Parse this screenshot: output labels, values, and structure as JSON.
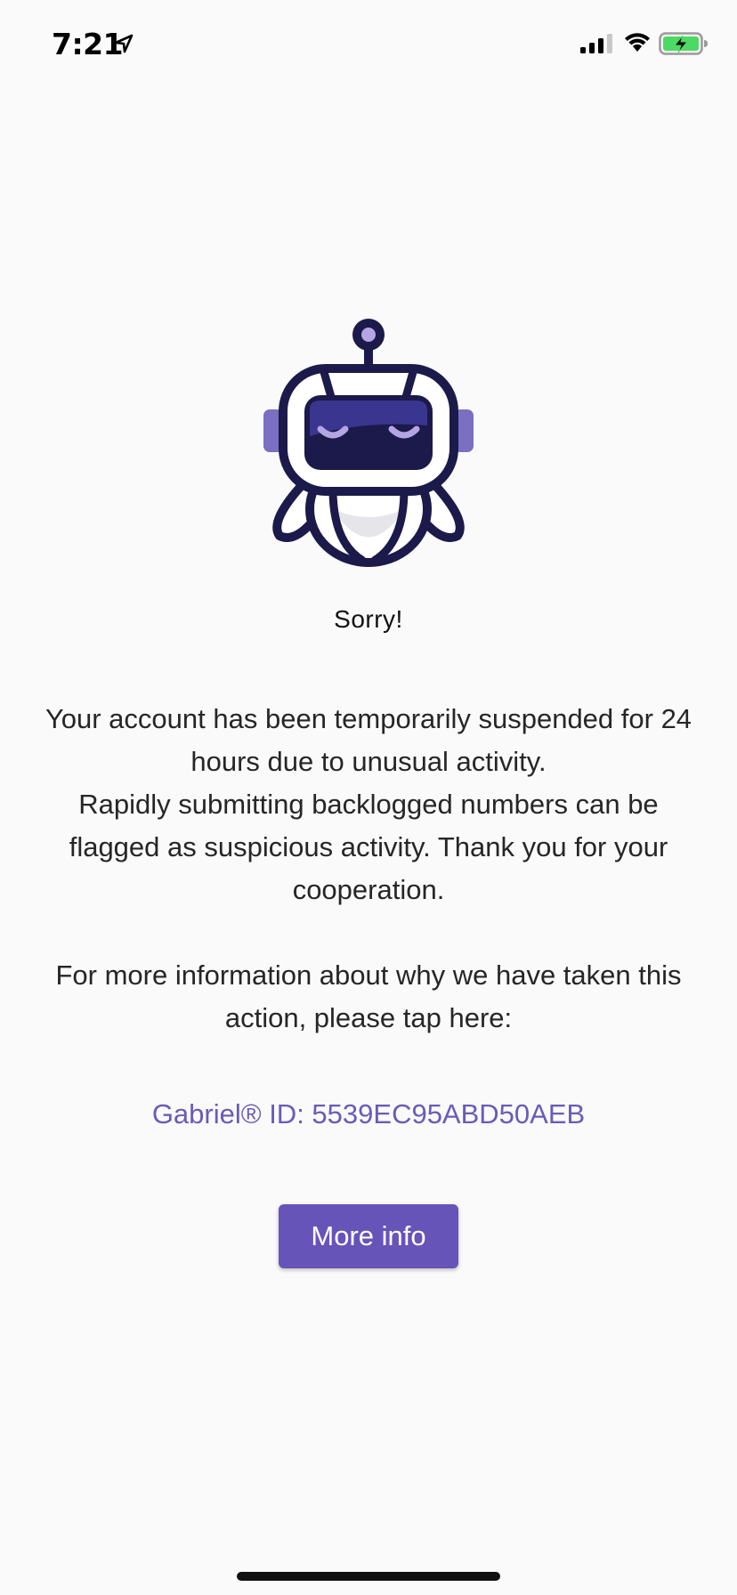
{
  "status_bar": {
    "time": "7:21",
    "location_icon": "location-arrow-icon",
    "signal_icon": "cell-signal-icon",
    "wifi_icon": "wifi-icon",
    "battery_icon": "battery-charging-icon",
    "battery_color": "#4cd964"
  },
  "illustration": {
    "icon": "robot-mascot-icon",
    "primary_color": "#1c1a4a",
    "accent_color": "#7a6fc0"
  },
  "title": "Sorry!",
  "message": {
    "line1": "Your account has been temporarily suspended for 24 hours due to unusual activity.",
    "line2": "Rapidly submitting backlogged numbers can be flagged as suspicious activity. Thank you for your cooperation."
  },
  "info_text": "For more information about why we have taken this action, please tap here:",
  "gabriel_id": "Gabriel® ID: 5539EC95ABD50AEB",
  "button": {
    "label": "More info",
    "color": "#6654b8"
  }
}
